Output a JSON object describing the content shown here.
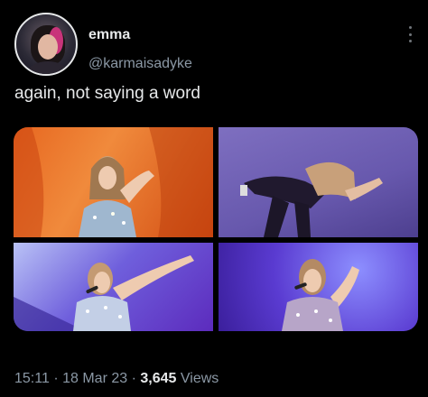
{
  "author": {
    "display_name": "emma",
    "handle": "@karmaisadyke"
  },
  "tweet": {
    "text": "again, not saying a word"
  },
  "media": [
    {
      "description_icon": "photo-icon"
    },
    {
      "description_icon": "photo-icon"
    },
    {
      "description_icon": "photo-icon"
    },
    {
      "description_icon": "photo-icon"
    }
  ],
  "meta": {
    "time": "15:11",
    "separator": "·",
    "date": "18 Mar 23",
    "views_count": "3,645",
    "views_label": "Views"
  },
  "icons": {
    "more": "more-options-icon"
  },
  "colors": {
    "background": "#000000",
    "text_primary": "#e7e9ea",
    "text_secondary": "#8b98a5"
  }
}
